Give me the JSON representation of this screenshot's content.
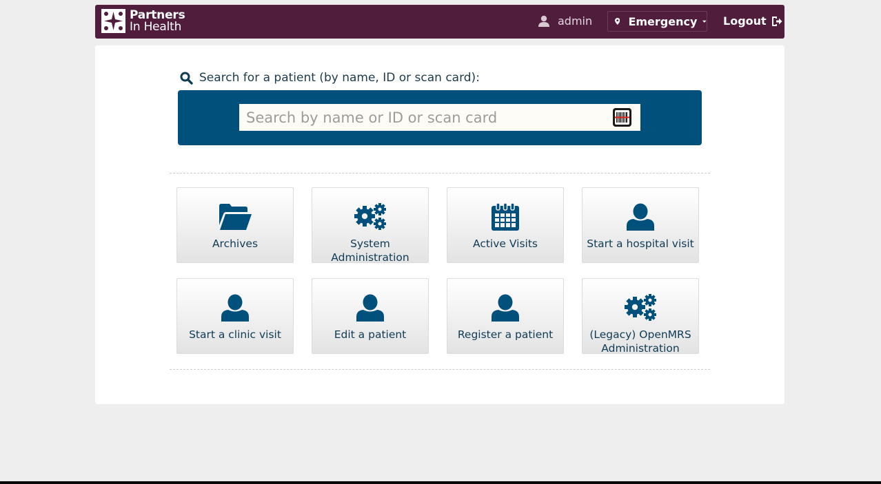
{
  "header": {
    "logo_line1": "Partners",
    "logo_line2": "In Health",
    "user": "admin",
    "location": "Emergency",
    "logout": "Logout",
    "brand_color": "#501d3d"
  },
  "search": {
    "label": "Search for a patient (by name, ID or scan card):",
    "placeholder": "Search by name or ID or scan card",
    "value": "",
    "box_color": "#00507c"
  },
  "apps": [
    {
      "label": "Archives",
      "icon": "folder-open-icon"
    },
    {
      "label": "System Administration",
      "icon": "gears-icon"
    },
    {
      "label": "Active Visits",
      "icon": "calendar-icon"
    },
    {
      "label": "Start a hospital visit",
      "icon": "user-icon"
    },
    {
      "label": "Start a clinic visit",
      "icon": "user-icon"
    },
    {
      "label": "Edit a patient",
      "icon": "user-icon"
    },
    {
      "label": "Register a patient",
      "icon": "user-icon"
    },
    {
      "label": "(Legacy) OpenMRS Administration",
      "icon": "gears-icon"
    }
  ],
  "colors": {
    "accent_text": "#0f3b55",
    "page_background": "#eeeeee"
  }
}
